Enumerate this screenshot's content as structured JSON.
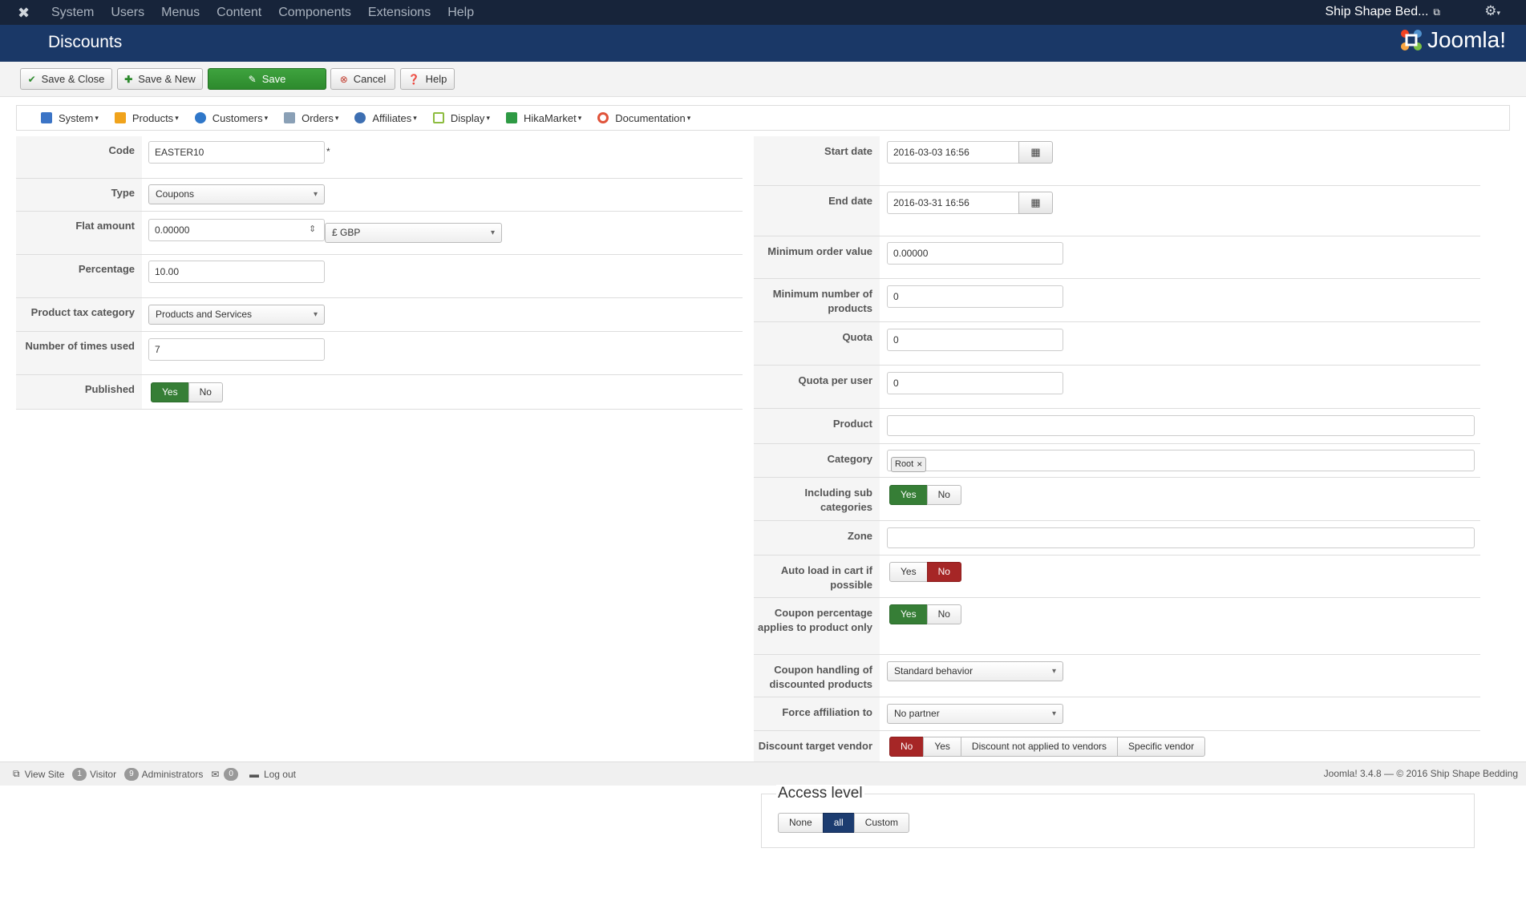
{
  "topnav": {
    "menu": [
      "System",
      "Users",
      "Menus",
      "Content",
      "Components",
      "Extensions",
      "Help"
    ],
    "site_name": "Ship Shape Bed...",
    "site_icon": "external-link-icon",
    "settings_icon": "gear-icon"
  },
  "header": {
    "title": "Discounts",
    "brand": "Joomla!"
  },
  "toolbar": {
    "save_close": "Save & Close",
    "save_new": "Save & New",
    "save": "Save",
    "cancel": "Cancel",
    "help": "Help"
  },
  "hikamenu": [
    {
      "label": "System",
      "icon": "wrench-icon",
      "color": "#3b74c6"
    },
    {
      "label": "Products",
      "icon": "box-icon",
      "color": "#f0a31c"
    },
    {
      "label": "Customers",
      "icon": "users-icon",
      "color": "#2f77c9"
    },
    {
      "label": "Orders",
      "icon": "orders-icon",
      "color": "#8aa0b6"
    },
    {
      "label": "Affiliates",
      "icon": "affiliates-icon",
      "color": "#3d6fb2"
    },
    {
      "label": "Display",
      "icon": "display-icon",
      "color": "#8dbc3f"
    },
    {
      "label": "HikaMarket",
      "icon": "hikamarket-icon",
      "color": "#2e9a44"
    },
    {
      "label": "Documentation",
      "icon": "lifebuoy-icon",
      "color": "#e0533a"
    }
  ],
  "left": {
    "code": {
      "label": "Code",
      "value": "EASTER10",
      "required": "*"
    },
    "type": {
      "label": "Type",
      "value": "Coupons"
    },
    "flat_amount": {
      "label": "Flat amount",
      "value": "0.00000",
      "currency": "£ GBP"
    },
    "percentage": {
      "label": "Percentage",
      "value": "10.00"
    },
    "tax_category": {
      "label": "Product tax category",
      "value": "Products and Services"
    },
    "times_used": {
      "label": "Number of times used",
      "value": "7"
    },
    "published": {
      "label": "Published",
      "yes": "Yes",
      "no": "No"
    }
  },
  "right": {
    "start_date": {
      "label": "Start date",
      "value": "2016-03-03 16:56"
    },
    "end_date": {
      "label": "End date",
      "value": "2016-03-31 16:56"
    },
    "min_order": {
      "label": "Minimum order value",
      "value": "0.00000"
    },
    "min_products": {
      "label": "Minimum number of products",
      "value": "0"
    },
    "quota": {
      "label": "Quota",
      "value": "0"
    },
    "quota_user": {
      "label": "Quota per user",
      "value": "0"
    },
    "product": {
      "label": "Product",
      "value": ""
    },
    "category": {
      "label": "Category",
      "tag": "Root",
      "remove": "×"
    },
    "sub_categories": {
      "label": "Including sub categories",
      "yes": "Yes",
      "no": "No"
    },
    "zone": {
      "label": "Zone",
      "value": ""
    },
    "auto_load": {
      "label": "Auto load in cart if possible",
      "yes": "Yes",
      "no": "No"
    },
    "coupon_pct": {
      "label": "Coupon percentage applies to product only",
      "yes": "Yes",
      "no": "No"
    },
    "coupon_handling": {
      "label": "Coupon handling of discounted products",
      "value": "Standard behavior"
    },
    "force_affiliation": {
      "label": "Force affiliation to",
      "value": "No partner"
    },
    "discount_target": {
      "label": "Discount target vendor",
      "opts": [
        "No",
        "Yes",
        "Discount not applied to vendors",
        "Specific vendor"
      ]
    }
  },
  "footer": {
    "view_site": "View Site",
    "visitors_count": "1",
    "visitors_label": "Visitor",
    "admins_count": "9",
    "admins_label": "Administrators",
    "messages_count": "0",
    "logout": "Log out",
    "copyright": "Joomla! 3.4.8  —  © 2016 Ship Shape Bedding"
  },
  "access": {
    "legend": "Access level",
    "opts": [
      "None",
      "all",
      "Custom"
    ]
  }
}
